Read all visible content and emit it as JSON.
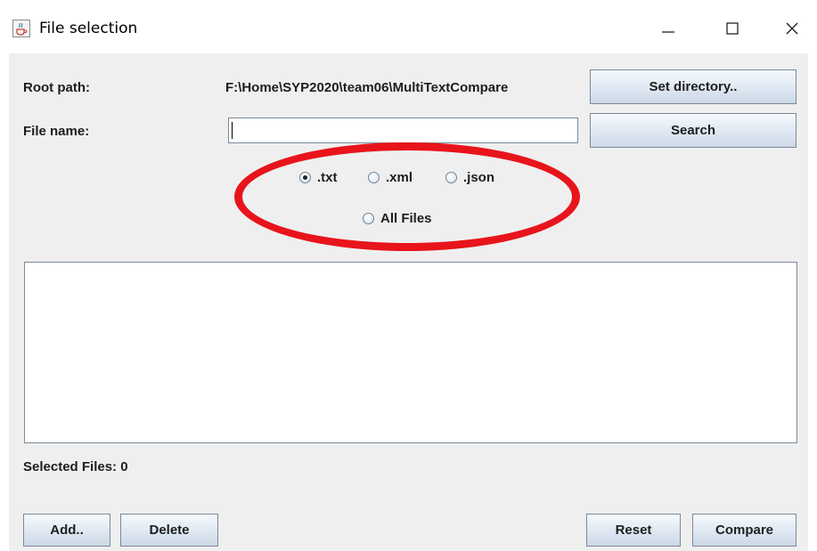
{
  "window": {
    "title": "File selection",
    "icon": "java-coffee-icon",
    "controls": [
      "minimize-icon",
      "maximize-icon",
      "close-icon"
    ]
  },
  "root_path": {
    "label": "Root path:",
    "value": "F:\\Home\\SYP2020\\team06\\MultiTextCompare",
    "button": "Set directory.."
  },
  "file_name": {
    "label": "File name:",
    "value": "",
    "button": "Search"
  },
  "file_types": {
    "options": [
      {
        "label": ".txt",
        "selected": true
      },
      {
        "label": ".xml",
        "selected": false
      },
      {
        "label": ".json",
        "selected": false
      },
      {
        "label": "All Files",
        "selected": false
      }
    ],
    "highlight_color": "#e8141b"
  },
  "file_list": {
    "items": []
  },
  "status": {
    "selected_label": "Selected Files:",
    "selected_count": "0"
  },
  "actions": {
    "add": "Add..",
    "delete": "Delete",
    "reset": "Reset",
    "compare": "Compare"
  }
}
